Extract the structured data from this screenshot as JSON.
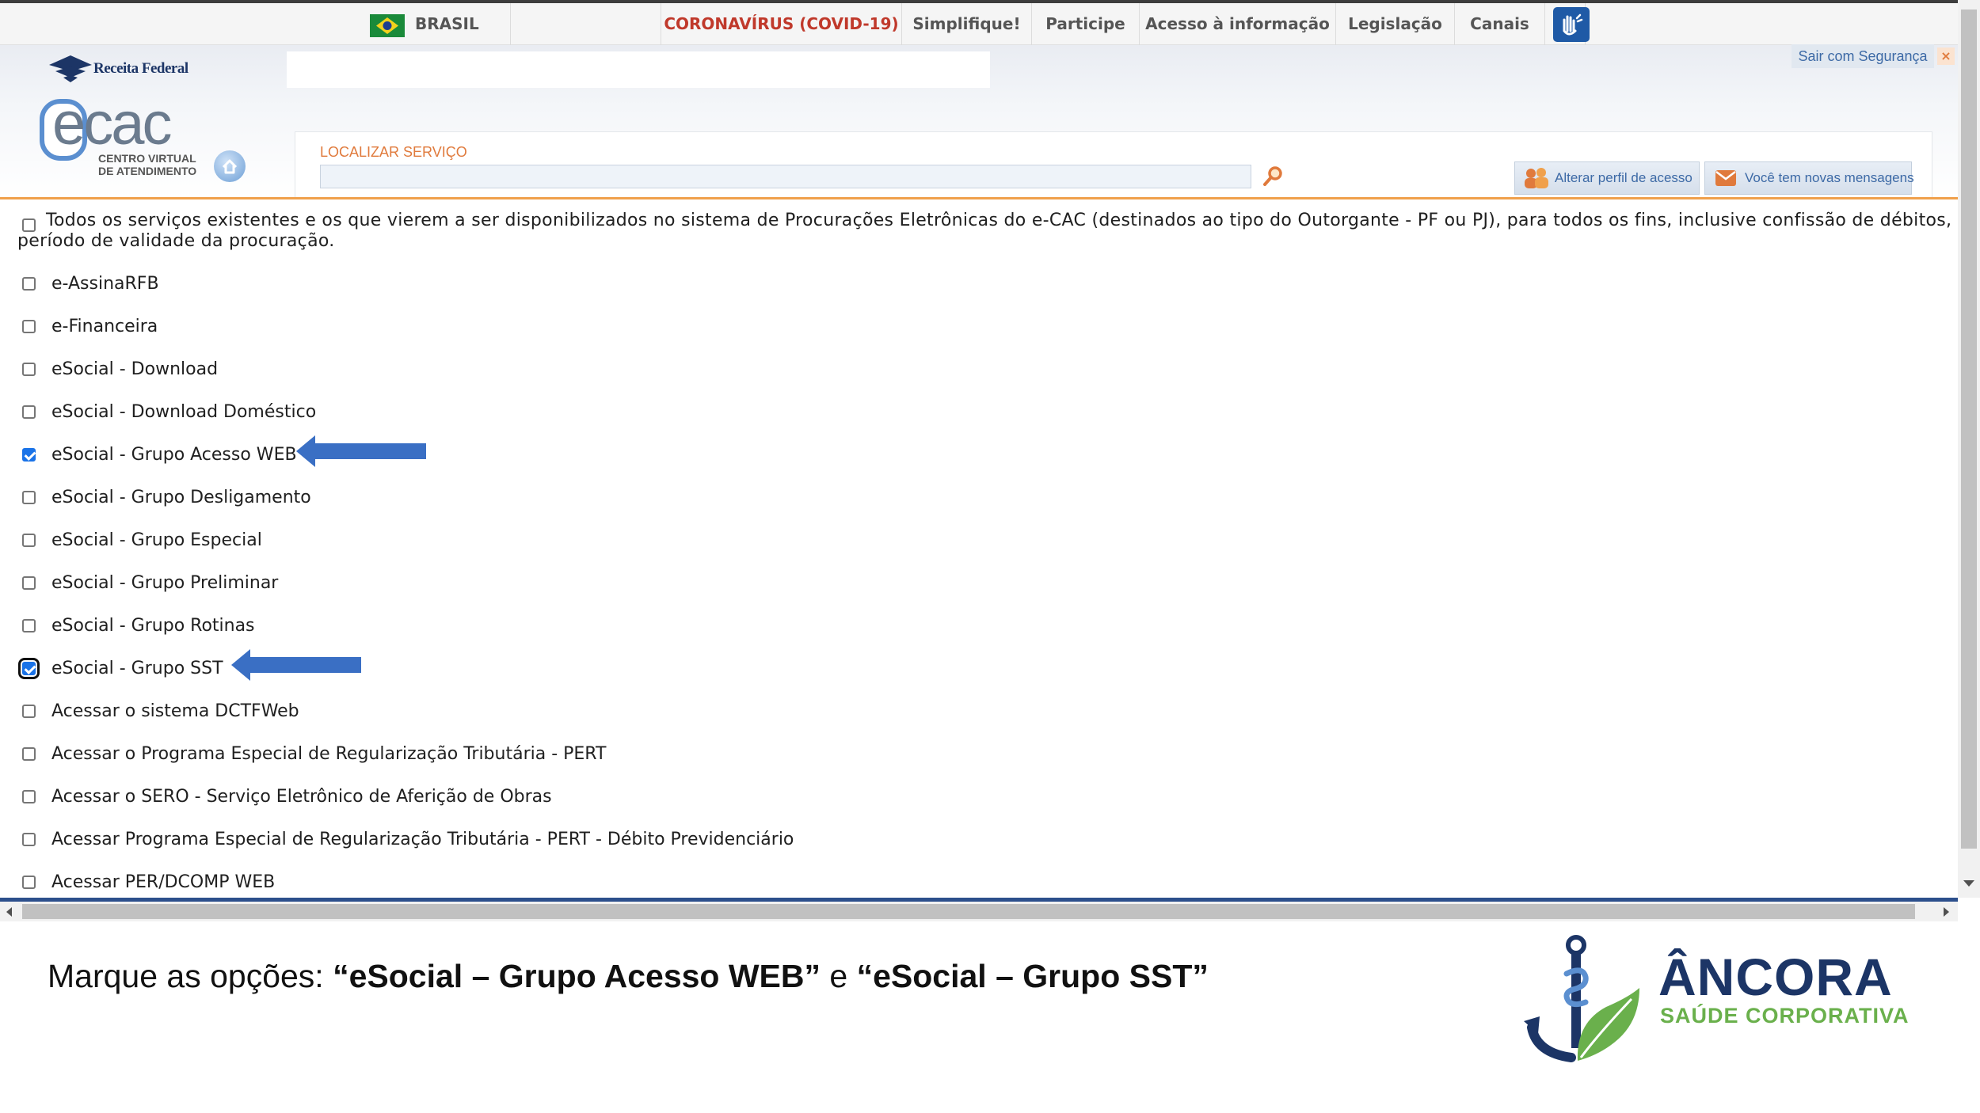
{
  "govbar": {
    "country": "BRASIL",
    "covid": "CORONAVÍRUS (COVID-19)",
    "links": [
      "Simplifique!",
      "Participe",
      "Acesso à informação",
      "Legislação",
      "Canais"
    ]
  },
  "header": {
    "agency": "Receita Federal",
    "logo_text": "ecac",
    "logo_sub1": "CENTRO VIRTUAL",
    "logo_sub2": "DE ATENDIMENTO",
    "logout_label": "Sair com Segurança",
    "search_label": "LOCALIZAR SERVIÇO",
    "search_value": "",
    "profile_button": "Alterar perfil de acesso",
    "messages_button": "Você tem novas mensagens"
  },
  "intro": {
    "line1": "Todos os serviços existentes e os que vierem a ser disponibilizados no sistema de Procurações Eletrônicas do e-CAC (destinados ao tipo do Outorgante - PF ou PJ), para todos os fins, inclusive confissão de débitos, durante o",
    "line2": "período de validade da procuração.",
    "checked": false
  },
  "services": [
    {
      "label": "e-AssinaRFB",
      "checked": false
    },
    {
      "label": "e-Financeira",
      "checked": false
    },
    {
      "label": "eSocial - Download",
      "checked": false
    },
    {
      "label": "eSocial - Download Doméstico",
      "checked": false
    },
    {
      "label": "eSocial - Grupo Acesso WEB",
      "checked": true
    },
    {
      "label": "eSocial - Grupo Desligamento",
      "checked": false
    },
    {
      "label": "eSocial - Grupo Especial",
      "checked": false
    },
    {
      "label": "eSocial - Grupo Preliminar",
      "checked": false
    },
    {
      "label": "eSocial - Grupo Rotinas",
      "checked": false
    },
    {
      "label": "eSocial - Grupo SST",
      "checked": true
    },
    {
      "label": "Acessar o sistema DCTFWeb",
      "checked": false
    },
    {
      "label": "Acessar o Programa Especial de Regularização Tributária - PERT",
      "checked": false
    },
    {
      "label": "Acessar o SERO - Serviço Eletrônico de Aferição de Obras",
      "checked": false
    },
    {
      "label": "Acessar Programa Especial de Regularização Tributária - PERT - Débito Previdenciário",
      "checked": false
    },
    {
      "label": "Acessar PER/DCOMP WEB",
      "checked": false
    }
  ],
  "caption": {
    "prefix": "Marque as opções: ",
    "opt1": "“eSocial – Grupo Acesso WEB”",
    "middle": " e ",
    "opt2": "“eSocial – Grupo SST”"
  },
  "brand": {
    "name": "ÂNCORA",
    "tagline": "SAÚDE CORPORATIVA"
  },
  "colors": {
    "arrow": "#3a6fc4",
    "brand_navy": "#1c3566",
    "brand_green": "#6ab04c",
    "covid_red": "#c0392b",
    "header_orange": "#f0a04b"
  }
}
